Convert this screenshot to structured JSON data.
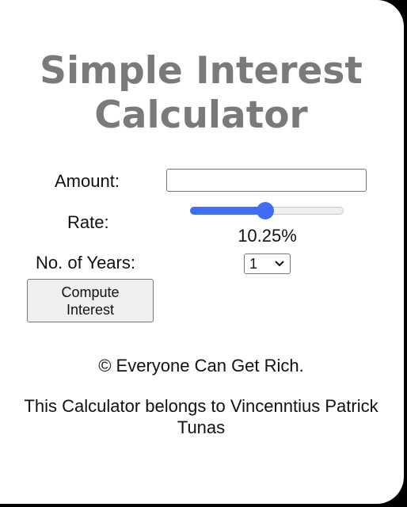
{
  "title_line1": "Simple Interest",
  "title_line2": "Calculator",
  "form": {
    "amount_label": "Amount:",
    "amount_value": "",
    "rate_label": "Rate:",
    "rate_slider_fraction": 0.49,
    "rate_value": "10.25%",
    "years_label": "No. of Years:",
    "years_selected": "1",
    "compute_button_label": "Compute Interest"
  },
  "footer": {
    "copyright": "© Everyone Can Get Rich.",
    "owner": "This Calculator belongs to Vincenntius Patrick Tunas"
  },
  "colors": {
    "title": "#7a7a7a",
    "slider_accent": "#3f6df6",
    "background_outer": "#000000",
    "card": "#ffffff"
  },
  "icons": {
    "select_arrow": "chevron-down-icon"
  }
}
